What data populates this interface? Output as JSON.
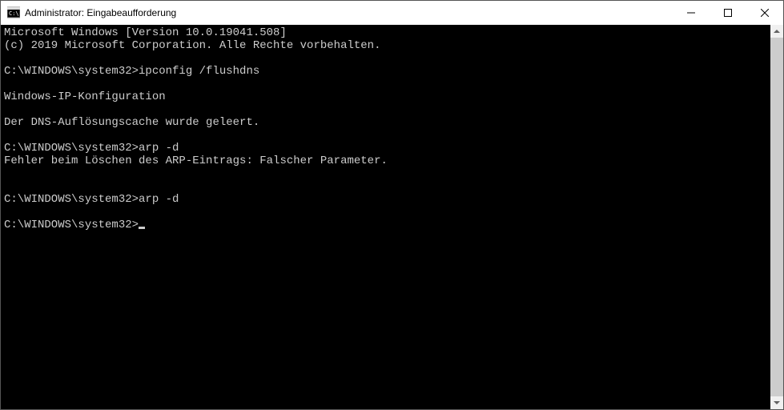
{
  "window": {
    "title": "Administrator: Eingabeaufforderung"
  },
  "terminal": {
    "lines": [
      "Microsoft Windows [Version 10.0.19041.508]",
      "(c) 2019 Microsoft Corporation. Alle Rechte vorbehalten.",
      "",
      "C:\\WINDOWS\\system32>ipconfig /flushdns",
      "",
      "Windows-IP-Konfiguration",
      "",
      "Der DNS-Auflösungscache wurde geleert.",
      "",
      "C:\\WINDOWS\\system32>arp -d",
      "Fehler beim Löschen des ARP-Eintrags: Falscher Parameter.",
      "",
      "",
      "C:\\WINDOWS\\system32>arp -d",
      "",
      "C:\\WINDOWS\\system32>"
    ]
  }
}
